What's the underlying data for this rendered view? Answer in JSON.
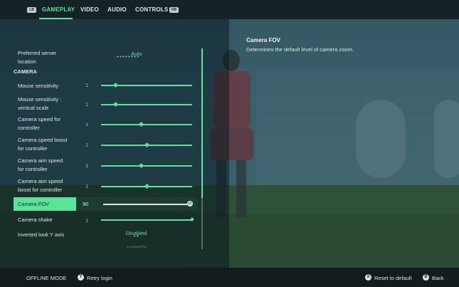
{
  "header": {
    "left_bumper": "LB",
    "right_bumper": "RB",
    "tabs": [
      {
        "label": "GAMEPLAY",
        "active": true
      },
      {
        "label": "VIDEO",
        "active": false
      },
      {
        "label": "AUDIO",
        "active": false
      },
      {
        "label": "CONTROLS",
        "active": false
      }
    ]
  },
  "settings": {
    "server": {
      "label_line1": "Preferred server",
      "label_line2": "location",
      "value": "Auto",
      "dots_total": 8,
      "dots_selected": 1
    },
    "section_title": "CAMERA",
    "sliders": [
      {
        "label_line1": "Mouse sensitivity",
        "label_line2": "",
        "value": "1",
        "level": 0.16
      },
      {
        "label_line1": "Mouse sensitivity :",
        "label_line2": "vertical scale",
        "value": "1",
        "level": 0.16
      },
      {
        "label_line1": "Camera speed for",
        "label_line2": "controller",
        "value": "1",
        "level": 0.44
      },
      {
        "label_line1": "Camera speed boost",
        "label_line2": "for controller",
        "value": "1",
        "level": 0.5
      },
      {
        "label_line1": "Camera aim speed",
        "label_line2": "for controller",
        "value": "1",
        "level": 0.44
      },
      {
        "label_line1": "Camera aim speed",
        "label_line2": "boost for controller",
        "value": "1",
        "level": 0.5
      }
    ],
    "fov": {
      "label": "Camera FOV",
      "value": "90",
      "level": 1.0,
      "knob_glyph": "⇄"
    },
    "shake": {
      "label": "Camera shake",
      "value": "1",
      "level": 1.0
    },
    "inverted": {
      "label": "Inverted look Y axis",
      "value": "Disabled",
      "dots_total": 2,
      "dots_selected": 0
    },
    "next_partial": "Disabled"
  },
  "description": {
    "title": "Camera FOV",
    "text": "Determines the default level of camera zoom."
  },
  "footer": {
    "status": "OFFLINE MODE",
    "retry_label": "Retry login",
    "retry_button_glyph": "Y",
    "reset_label": "Reset to default",
    "reset_button_glyph": "X",
    "back_label": "Back",
    "back_button_glyph": "B"
  },
  "colors": {
    "accent": "#58e59a",
    "panel": "#1d3c30"
  }
}
